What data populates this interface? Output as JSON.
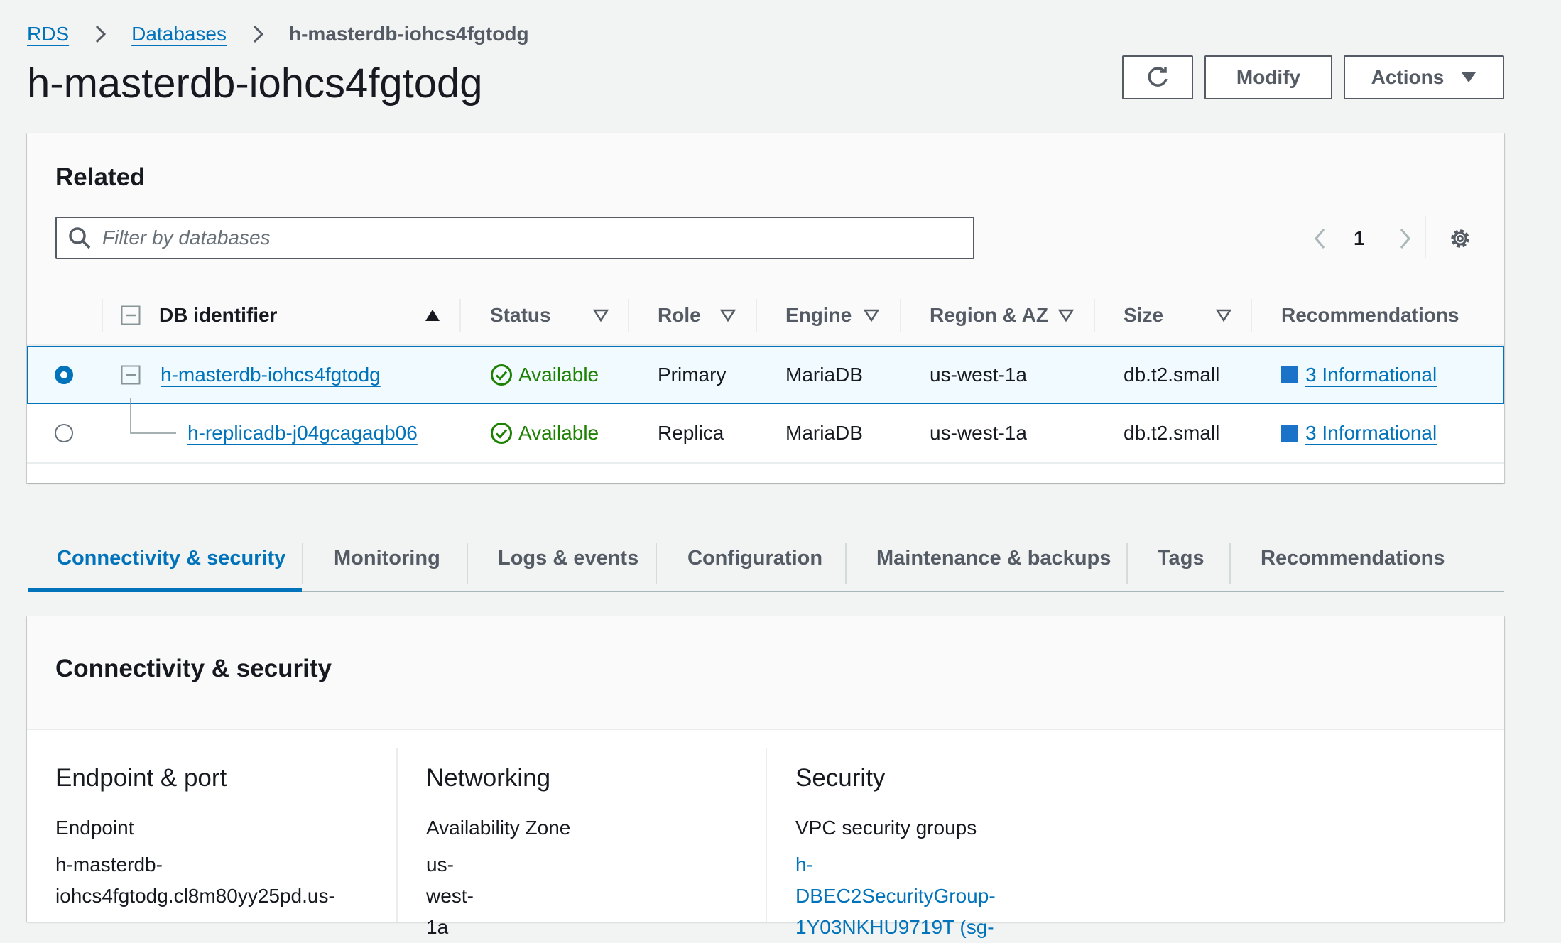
{
  "breadcrumb": {
    "items": [
      {
        "label": "RDS"
      },
      {
        "label": "Databases"
      },
      {
        "label": "h-masterdb-iohcs4fgtodg"
      }
    ]
  },
  "page": {
    "title": "h-masterdb-iohcs4fgtodg"
  },
  "header_buttons": {
    "modify": "Modify",
    "actions": "Actions",
    "refresh_icon": "refresh-icon"
  },
  "related": {
    "title": "Related",
    "search_placeholder": "Filter by databases",
    "page_number": "1",
    "columns": [
      "DB identifier",
      "Status",
      "Role",
      "Engine",
      "Region & AZ",
      "Size",
      "Recommendations"
    ],
    "rows": [
      {
        "selected": true,
        "identifier": "h-masterdb-iohcs4fgtodg",
        "status": "Available",
        "role": "Primary",
        "engine": "MariaDB",
        "region": "us-west-1a",
        "size": "db.t2.small",
        "recommendations": "3 Informational"
      },
      {
        "selected": false,
        "identifier": "h-replicadb-j04gcagaqb06",
        "status": "Available",
        "role": "Replica",
        "engine": "MariaDB",
        "region": "us-west-1a",
        "size": "db.t2.small",
        "recommendations": "3 Informational"
      }
    ]
  },
  "tabs": [
    {
      "label": "Connectivity & security",
      "active": true
    },
    {
      "label": "Monitoring"
    },
    {
      "label": "Logs & events"
    },
    {
      "label": "Configuration"
    },
    {
      "label": "Maintenance & backups"
    },
    {
      "label": "Tags"
    },
    {
      "label": "Recommendations"
    }
  ],
  "connectivity": {
    "title": "Connectivity & security",
    "endpoint_port": {
      "heading": "Endpoint & port",
      "label": "Endpoint",
      "value_line1": "h-masterdb-",
      "value_line2": "iohcs4fgtodg.cl8m80yy25pd.us-"
    },
    "networking": {
      "heading": "Networking",
      "label": "Availability Zone",
      "value": "us-west-1a"
    },
    "security": {
      "heading": "Security",
      "label": "VPC security groups",
      "value_line1": "h-DBEC2SecurityGroup-",
      "value_line2": "1Y03NKHU9719T (sg-"
    }
  },
  "colors": {
    "link": "#0073bb",
    "success": "#1d8102",
    "text": "#16191f",
    "secondary": "#545b64",
    "background": "#f2f3f3"
  }
}
